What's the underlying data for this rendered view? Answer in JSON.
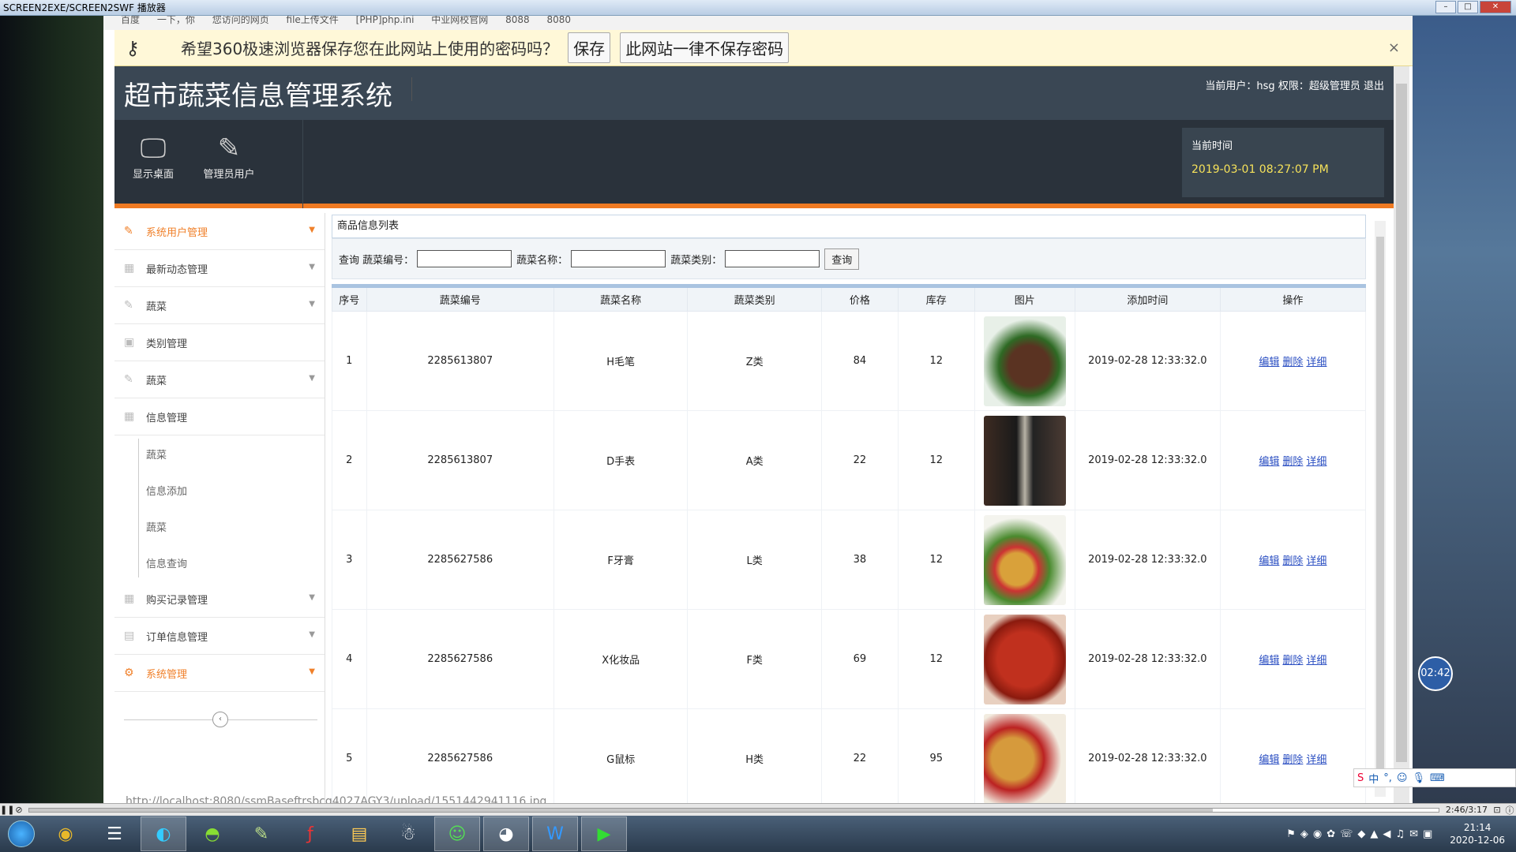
{
  "player": {
    "title": "SCREEN2EXE/SCREEN2SWF 播放器",
    "min": "–",
    "max": "□",
    "close": "✕"
  },
  "bookmarks": [
    "百度",
    "一下，你",
    "您访问的网页",
    "file上传文件",
    "[PHP]php.ini",
    "中业网校官网",
    "8088",
    "8080"
  ],
  "pwbar": {
    "message": "希望360极速浏览器保存您在此网站上使用的密码吗？",
    "save": "保存",
    "never": "此网站一律不保存密码",
    "close": "×"
  },
  "header": {
    "system_title": "超市蔬菜信息管理系统",
    "user_prefix": "当前用户：",
    "username": "hsg",
    "role_prefix": "权限：",
    "role": "超级管理员",
    "logout": "退出"
  },
  "nav": {
    "desktop": "显示桌面",
    "admin": "管理员用户"
  },
  "timebox": {
    "label": "当前时间",
    "value": "2019-03-01 08:27:07 PM"
  },
  "sidebar": {
    "items": [
      {
        "label": "系统用户管理",
        "active": true
      },
      {
        "label": "最新动态管理"
      },
      {
        "label": "蔬菜"
      },
      {
        "label": "类别管理"
      },
      {
        "label": "蔬菜"
      },
      {
        "label": "信息管理"
      }
    ],
    "subitems": [
      "蔬菜",
      "信息添加",
      "蔬菜",
      "信息查询"
    ],
    "bottom_items": [
      {
        "label": "购买记录管理"
      },
      {
        "label": "订单信息管理"
      },
      {
        "label": "系统管理",
        "active": true
      }
    ],
    "collapse": "‹"
  },
  "panel": {
    "title": "商品信息列表",
    "query_label": "查询",
    "f1": "蔬菜编号：",
    "f2": "蔬菜名称：",
    "f3": "蔬菜类别：",
    "query_button": "查询"
  },
  "table": {
    "headers": [
      "序号",
      "蔬菜编号",
      "蔬菜名称",
      "蔬菜类别",
      "价格",
      "库存",
      "图片",
      "添加时间",
      "操作"
    ],
    "rows": [
      {
        "no": "1",
        "code": "2285613807",
        "name": "H毛笔",
        "cat": "Z类",
        "price": "84",
        "stock": "12",
        "time": "2019-02-28 12:33:32.0"
      },
      {
        "no": "2",
        "code": "2285613807",
        "name": "D手表",
        "cat": "A类",
        "price": "22",
        "stock": "12",
        "time": "2019-02-28 12:33:32.0"
      },
      {
        "no": "3",
        "code": "2285627586",
        "name": "F牙膏",
        "cat": "L类",
        "price": "38",
        "stock": "12",
        "time": "2019-02-28 12:33:32.0"
      },
      {
        "no": "4",
        "code": "2285627586",
        "name": "X化妆品",
        "cat": "F类",
        "price": "69",
        "stock": "12",
        "time": "2019-02-28 12:33:32.0"
      },
      {
        "no": "5",
        "code": "2285627586",
        "name": "G鼠标",
        "cat": "H类",
        "price": "22",
        "stock": "95",
        "time": "2019-02-28 12:33:32.0"
      }
    ],
    "actions": {
      "edit": "编辑",
      "delete": "删除",
      "detail": "详细"
    }
  },
  "status_url": "http://localhost:8080/ssmBaseftrsbcg4027AGY3/upload/1551442941116.jpg",
  "timer": "02:42",
  "ime": {
    "label": "中"
  },
  "playerbar": {
    "time": "2:46/3:17",
    "progress": 0.84
  },
  "taskbar": {
    "apps": [
      "chrome-icon",
      "media-icon",
      "browser-icon",
      "360-icon",
      "notepad-icon",
      "flash-icon",
      "folder-icon",
      "qq-icon",
      "wechat-icon",
      "qq-penguin-icon",
      "wps-icon",
      "screen-recorder-icon"
    ]
  },
  "clock": {
    "time": "21:14",
    "date": "2020-12-06"
  }
}
